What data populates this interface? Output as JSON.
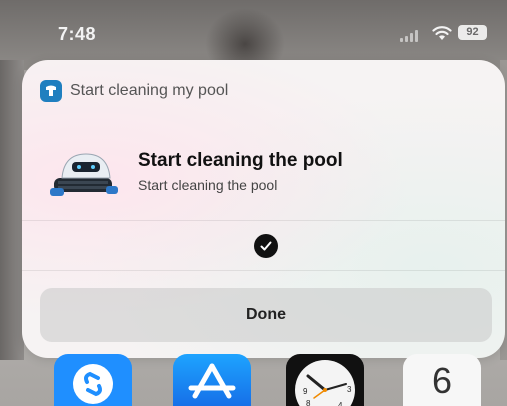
{
  "status_bar": {
    "time": "7:48",
    "battery_level": "92",
    "signal_icon": "cellular-signal-icon",
    "wifi_icon": "wifi-icon"
  },
  "sheet": {
    "app_icon": "pool-robot-app-icon",
    "app_title": "Start cleaning my pool",
    "shortcut": {
      "image": "pool-cleaning-robot-image",
      "title": "Start cleaning the pool",
      "subtitle": "Start cleaning the pool"
    },
    "status_icon": "checkmark-circle-icon",
    "done_label": "Done"
  },
  "dock": {
    "apps": [
      {
        "icon": "shazam-icon"
      },
      {
        "icon": "app-store-icon"
      },
      {
        "icon": "clock-icon"
      },
      {
        "icon": "calendar-icon",
        "label": "6"
      }
    ]
  },
  "colors": {
    "shazam": "#1f8fff",
    "app_store": "#1d8af5",
    "check_badge": "#111111",
    "app_icon": "#1f7fbf"
  }
}
